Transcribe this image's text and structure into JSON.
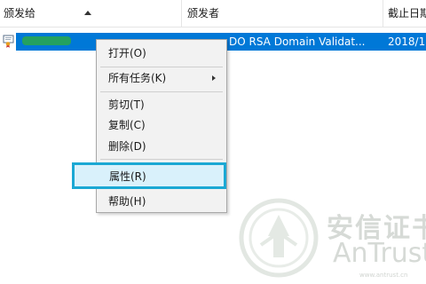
{
  "columns": {
    "issued_to": "颁发给",
    "issued_by": "颁发者",
    "expiration": "截止日期"
  },
  "row": {
    "issued_by": "DO RSA Domain Validat...",
    "expiration": "2018/1"
  },
  "menu": {
    "open": "打开(O)",
    "all_tasks": "所有任务(K)",
    "cut": "剪切(T)",
    "copy": "复制(C)",
    "delete": "删除(D)",
    "properties": "属性(R)",
    "help": "帮助(H)"
  },
  "watermark": {
    "cn": "安信证书",
    "en": "AnTrust",
    "url": "www.antrust.cn"
  },
  "colors": {
    "selection": "#0078d7",
    "highlight_border": "#1aa8d4",
    "highlight_fill": "#d9f1fb",
    "menu_bg": "#f2f2f2"
  },
  "icons": {
    "sort": "sort-ascending-icon",
    "certificate": "certificate-icon",
    "submenu": "chevron-right-icon",
    "watermark": "antrust-logo-icon"
  }
}
